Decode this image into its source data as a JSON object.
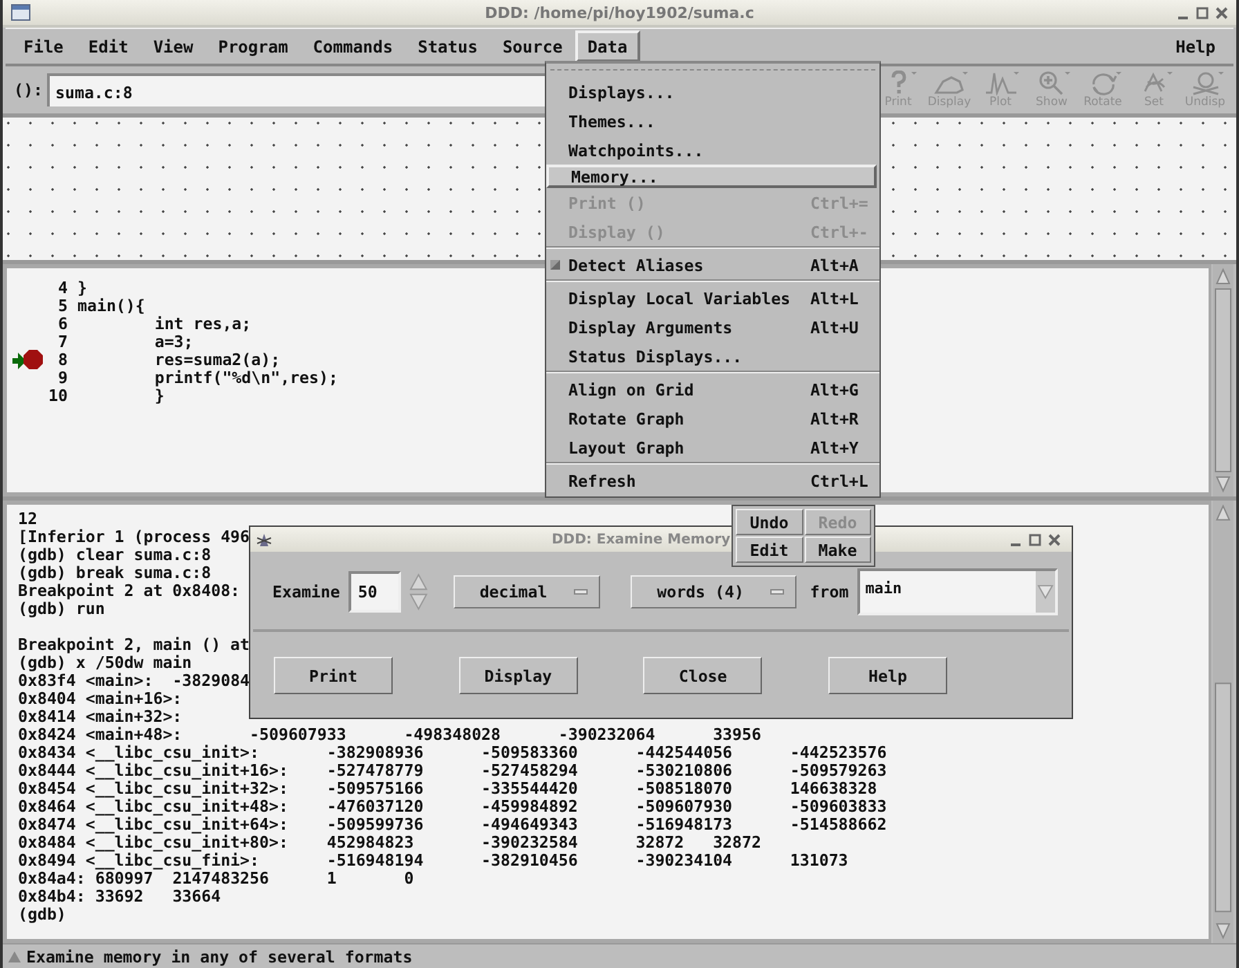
{
  "window": {
    "title": "DDD: /home/pi/hoy1902/suma.c"
  },
  "menubar": [
    {
      "label": "File",
      "selected": false
    },
    {
      "label": "Edit",
      "selected": false
    },
    {
      "label": "View",
      "selected": false
    },
    {
      "label": "Program",
      "selected": false
    },
    {
      "label": "Commands",
      "selected": false
    },
    {
      "label": "Status",
      "selected": false
    },
    {
      "label": "Source",
      "selected": false
    },
    {
      "label": "Data",
      "selected": true
    }
  ],
  "help_menu": {
    "label": "Help",
    "selected": false
  },
  "argument": {
    "label": "():",
    "value": "suma.c:8"
  },
  "toolbar": [
    {
      "kind": "print",
      "label": "Print",
      "disabled": true
    },
    {
      "kind": "display",
      "label": "Display",
      "disabled": true
    },
    {
      "kind": "plot",
      "label": "Plot",
      "disabled": true
    },
    {
      "kind": "show",
      "label": "Show",
      "disabled": true
    },
    {
      "kind": "rotate",
      "label": "Rotate",
      "disabled": true
    },
    {
      "kind": "set",
      "label": "Set",
      "disabled": true
    },
    {
      "kind": "undisp",
      "label": "Undisp",
      "disabled": true
    }
  ],
  "source": {
    "lines": [
      {
        "number": "4",
        "code": "}",
        "breakpoint": false,
        "current": false
      },
      {
        "number": "5",
        "code": "main(){",
        "breakpoint": false,
        "current": false
      },
      {
        "number": "6",
        "code": "\tint res,a;",
        "breakpoint": false,
        "current": false
      },
      {
        "number": "7",
        "code": "\ta=3;",
        "breakpoint": false,
        "current": false
      },
      {
        "number": "8",
        "code": "\tres=suma2(a);",
        "breakpoint": true,
        "current": true
      },
      {
        "number": "9",
        "code": "\tprintf(\"%d\\n\",res);",
        "breakpoint": false,
        "current": false
      },
      {
        "number": "10",
        "code": "\t}",
        "breakpoint": false,
        "current": false
      }
    ]
  },
  "console": {
    "lines": [
      {
        "text": "12"
      },
      {
        "text": "[Inferior 1 (process 496"
      },
      {
        "text": "(gdb) clear suma.c:8"
      },
      {
        "text": "(gdb) break suma.c:8"
      },
      {
        "text": "Breakpoint 2 at 0x8408:"
      },
      {
        "text": "(gdb) run"
      },
      {
        "text": "Breakpoint 2, main () at",
        "space_before": true
      },
      {
        "text": "(gdb) x /50dw main"
      },
      {
        "text": "0x83f4 <main>:\t-3829084"
      },
      {
        "text": "0x8404 <main+16>:"
      },
      {
        "text": "0x8414 <main+32>:"
      },
      {
        "text": "0x8424 <main+48>:\t-509607933\t-498348028\t-390232064\t33956"
      },
      {
        "text": "0x8434 <__libc_csu_init>:\t-382908936\t-509583360\t-442544056\t-442523576"
      },
      {
        "text": "0x8444 <__libc_csu_init+16>:\t-527478779\t-527458294\t-530210806\t-509579263"
      },
      {
        "text": "0x8454 <__libc_csu_init+32>:\t-509575166\t-335544420\t-508518070\t146638328"
      },
      {
        "text": "0x8464 <__libc_csu_init+48>:\t-476037120\t-459984892\t-509607930\t-509603833"
      },
      {
        "text": "0x8474 <__libc_csu_init+64>:\t-509599736\t-494649343\t-516948173\t-514588662"
      },
      {
        "text": "0x8484 <__libc_csu_init+80>:\t452984823\t-390232584\t32872\t32872"
      },
      {
        "text": "0x8494 <__libc_csu_fini>:\t-516948194\t-382910456\t-390234104\t131073"
      },
      {
        "text": "0x84a4:\t680997\t2147483256\t1\t0"
      },
      {
        "text": "0x84b4:\t33692\t33664"
      },
      {
        "text": "(gdb)"
      }
    ]
  },
  "status_bar": {
    "text": "Examine memory in any of several formats"
  },
  "data_menu": {
    "items": [
      {
        "kind": "tearoff"
      },
      {
        "kind": "item",
        "label": "Displays...",
        "disabled": false,
        "selected": false
      },
      {
        "kind": "item",
        "label": "Themes...",
        "disabled": false,
        "selected": false
      },
      {
        "kind": "item",
        "label": "Watchpoints...",
        "disabled": false,
        "selected": false
      },
      {
        "kind": "item",
        "label": "Memory...",
        "disabled": false,
        "selected": true
      },
      {
        "kind": "item",
        "label": "Print ()",
        "shortcut": "Ctrl+=",
        "disabled": true,
        "selected": false
      },
      {
        "kind": "item",
        "label": "Display ()",
        "shortcut": "Ctrl+-",
        "disabled": true,
        "selected": false
      },
      {
        "kind": "separator"
      },
      {
        "kind": "check",
        "label": "Detect Aliases",
        "shortcut": "Alt+A",
        "checked": true,
        "disabled": false,
        "selected": false
      },
      {
        "kind": "separator"
      },
      {
        "kind": "item",
        "label": "Display Local Variables",
        "shortcut": "Alt+L",
        "disabled": false,
        "selected": false
      },
      {
        "kind": "item",
        "label": "Display Arguments",
        "shortcut": "Alt+U",
        "disabled": false,
        "selected": false
      },
      {
        "kind": "item",
        "label": "Status Displays...",
        "disabled": false,
        "selected": false
      },
      {
        "kind": "separator"
      },
      {
        "kind": "item",
        "label": "Align on Grid",
        "shortcut": "Alt+G",
        "disabled": false,
        "selected": false
      },
      {
        "kind": "item",
        "label": "Rotate Graph",
        "shortcut": "Alt+R",
        "disabled": false,
        "selected": false
      },
      {
        "kind": "item",
        "label": "Layout Graph",
        "shortcut": "Alt+Y",
        "disabled": false,
        "selected": false
      },
      {
        "kind": "separator"
      },
      {
        "kind": "item",
        "label": "Refresh",
        "shortcut": "Ctrl+L",
        "disabled": false,
        "selected": false
      }
    ]
  },
  "command_tool": {
    "buttons": [
      {
        "label": "Undo",
        "disabled": false
      },
      {
        "label": "Redo",
        "disabled": true
      },
      {
        "label": "Edit",
        "disabled": false
      },
      {
        "label": "Make",
        "disabled": false
      }
    ]
  },
  "examine_dialog": {
    "title": "DDD: Examine Memory",
    "examine_label": "Examine",
    "count": "50",
    "format": "decimal",
    "size": "words (4)",
    "from_label": "from",
    "address": "main",
    "buttons": [
      "Print",
      "Display",
      "Close",
      "Help"
    ]
  }
}
